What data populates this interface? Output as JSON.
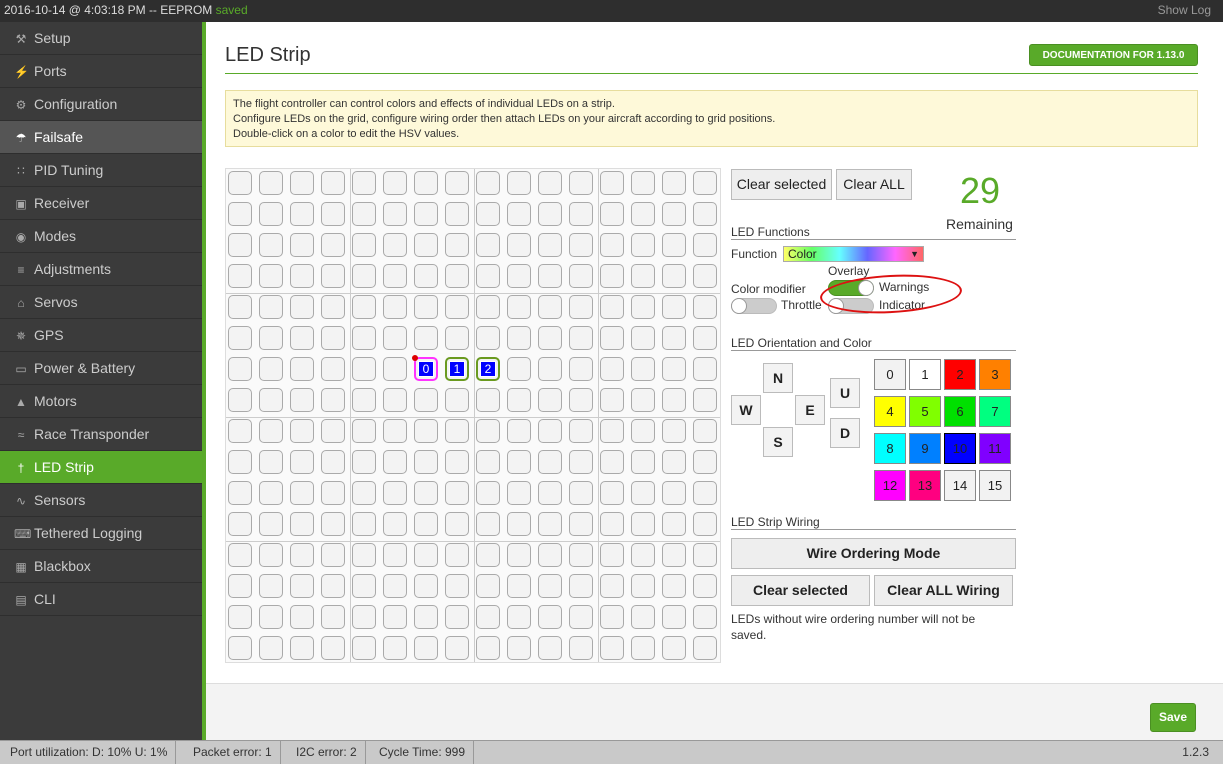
{
  "topbar": {
    "log_title": "2016-10-14 @ 4:03:18 PM -- EEPROM ",
    "log_saved": "saved",
    "show_log": "Show Log"
  },
  "sidebar": {
    "items": [
      {
        "label": "Setup",
        "icon": "wrench-icon"
      },
      {
        "label": "Ports",
        "icon": "plug-icon"
      },
      {
        "label": "Configuration",
        "icon": "gear-icon"
      },
      {
        "label": "Failsafe",
        "icon": "parachute-icon"
      },
      {
        "label": "PID Tuning",
        "icon": "tree-icon"
      },
      {
        "label": "Receiver",
        "icon": "receiver-icon"
      },
      {
        "label": "Modes",
        "icon": "toggle-icon"
      },
      {
        "label": "Adjustments",
        "icon": "sliders-icon"
      },
      {
        "label": "Servos",
        "icon": "servo-icon"
      },
      {
        "label": "GPS",
        "icon": "satellite-icon"
      },
      {
        "label": "Power & Battery",
        "icon": "battery-icon"
      },
      {
        "label": "Motors",
        "icon": "motor-icon"
      },
      {
        "label": "Race Transponder",
        "icon": "transponder-icon"
      },
      {
        "label": "LED Strip",
        "icon": "bulb-icon"
      },
      {
        "label": "Sensors",
        "icon": "pulse-icon"
      },
      {
        "label": "Tethered Logging",
        "icon": "keyboard-icon"
      },
      {
        "label": "Blackbox",
        "icon": "film-icon"
      },
      {
        "label": "CLI",
        "icon": "terminal-icon"
      }
    ],
    "hover_index": 3,
    "active_index": 13
  },
  "page": {
    "title": "LED Strip",
    "doc_button": "DOCUMENTATION FOR 1.13.0",
    "note_lines": [
      "The flight controller can control colors and effects of individual LEDs on a strip.",
      "Configure LEDs on the grid, configure wiring order then attach LEDs on your aircraft according to grid positions.",
      "Double-click on a color to edit the HSV values."
    ]
  },
  "grid": {
    "rows": 16,
    "cols": 16,
    "leds": [
      {
        "row": 6,
        "col": 6,
        "label": "0",
        "border": "#ff33ff"
      },
      {
        "row": 6,
        "col": 7,
        "label": "1",
        "border": "#6a9a1f"
      },
      {
        "row": 6,
        "col": 8,
        "label": "2",
        "border": "#6a9a1f"
      }
    ]
  },
  "controls": {
    "clear_selected": "Clear selected",
    "clear_all": "Clear ALL",
    "remaining_count": "29",
    "remaining_label": "Remaining",
    "led_functions_label": "LED Functions",
    "function_label": "Function",
    "function_value": "Color",
    "overlay_label": "Overlay",
    "color_modifier_label": "Color modifier",
    "throttle_label": "Throttle",
    "warnings_label": "Warnings",
    "indicator_label": "Indicator",
    "warnings_on": true,
    "throttle_on": false,
    "indicator_on": false,
    "orientation_label": "LED Orientation and Color",
    "directions": {
      "n": "N",
      "w": "W",
      "e": "E",
      "s": "S",
      "u": "U",
      "d": "D"
    },
    "colors": [
      {
        "label": "0",
        "bg": "#f2f2f2"
      },
      {
        "label": "1",
        "bg": "#ffffff"
      },
      {
        "label": "2",
        "bg": "#ff0000"
      },
      {
        "label": "3",
        "bg": "#ff8000"
      },
      {
        "label": "4",
        "bg": "#ffff00"
      },
      {
        "label": "5",
        "bg": "#80ff00"
      },
      {
        "label": "6",
        "bg": "#00e000"
      },
      {
        "label": "7",
        "bg": "#00ff80"
      },
      {
        "label": "8",
        "bg": "#00ffff"
      },
      {
        "label": "9",
        "bg": "#0080ff"
      },
      {
        "label": "10",
        "bg": "#0000ff"
      },
      {
        "label": "11",
        "bg": "#8000ff"
      },
      {
        "label": "12",
        "bg": "#ff00ff"
      },
      {
        "label": "13",
        "bg": "#ff0080"
      },
      {
        "label": "14",
        "bg": "#f2f2f2"
      },
      {
        "label": "15",
        "bg": "#f2f2f2"
      }
    ],
    "wiring_label": "LED Strip Wiring",
    "wire_ordering_mode": "Wire Ordering Mode",
    "wiring_clear_selected": "Clear selected",
    "wiring_clear_all": "Clear ALL Wiring",
    "wiring_note": "LEDs without wire ordering number will not be saved."
  },
  "footer": {
    "save": "Save"
  },
  "status": {
    "port_utilization": "Port utilization: D: 10% U: 1%",
    "packet_error": "Packet error: 1",
    "i2c_error": "I2C error: 2",
    "cycle_time": "Cycle Time: 999",
    "version": "1.2.3"
  },
  "colors": {
    "accent": "#59aa29",
    "sidebar_bg": "#3b3b3b",
    "topbar_bg": "#2e2e2e"
  }
}
